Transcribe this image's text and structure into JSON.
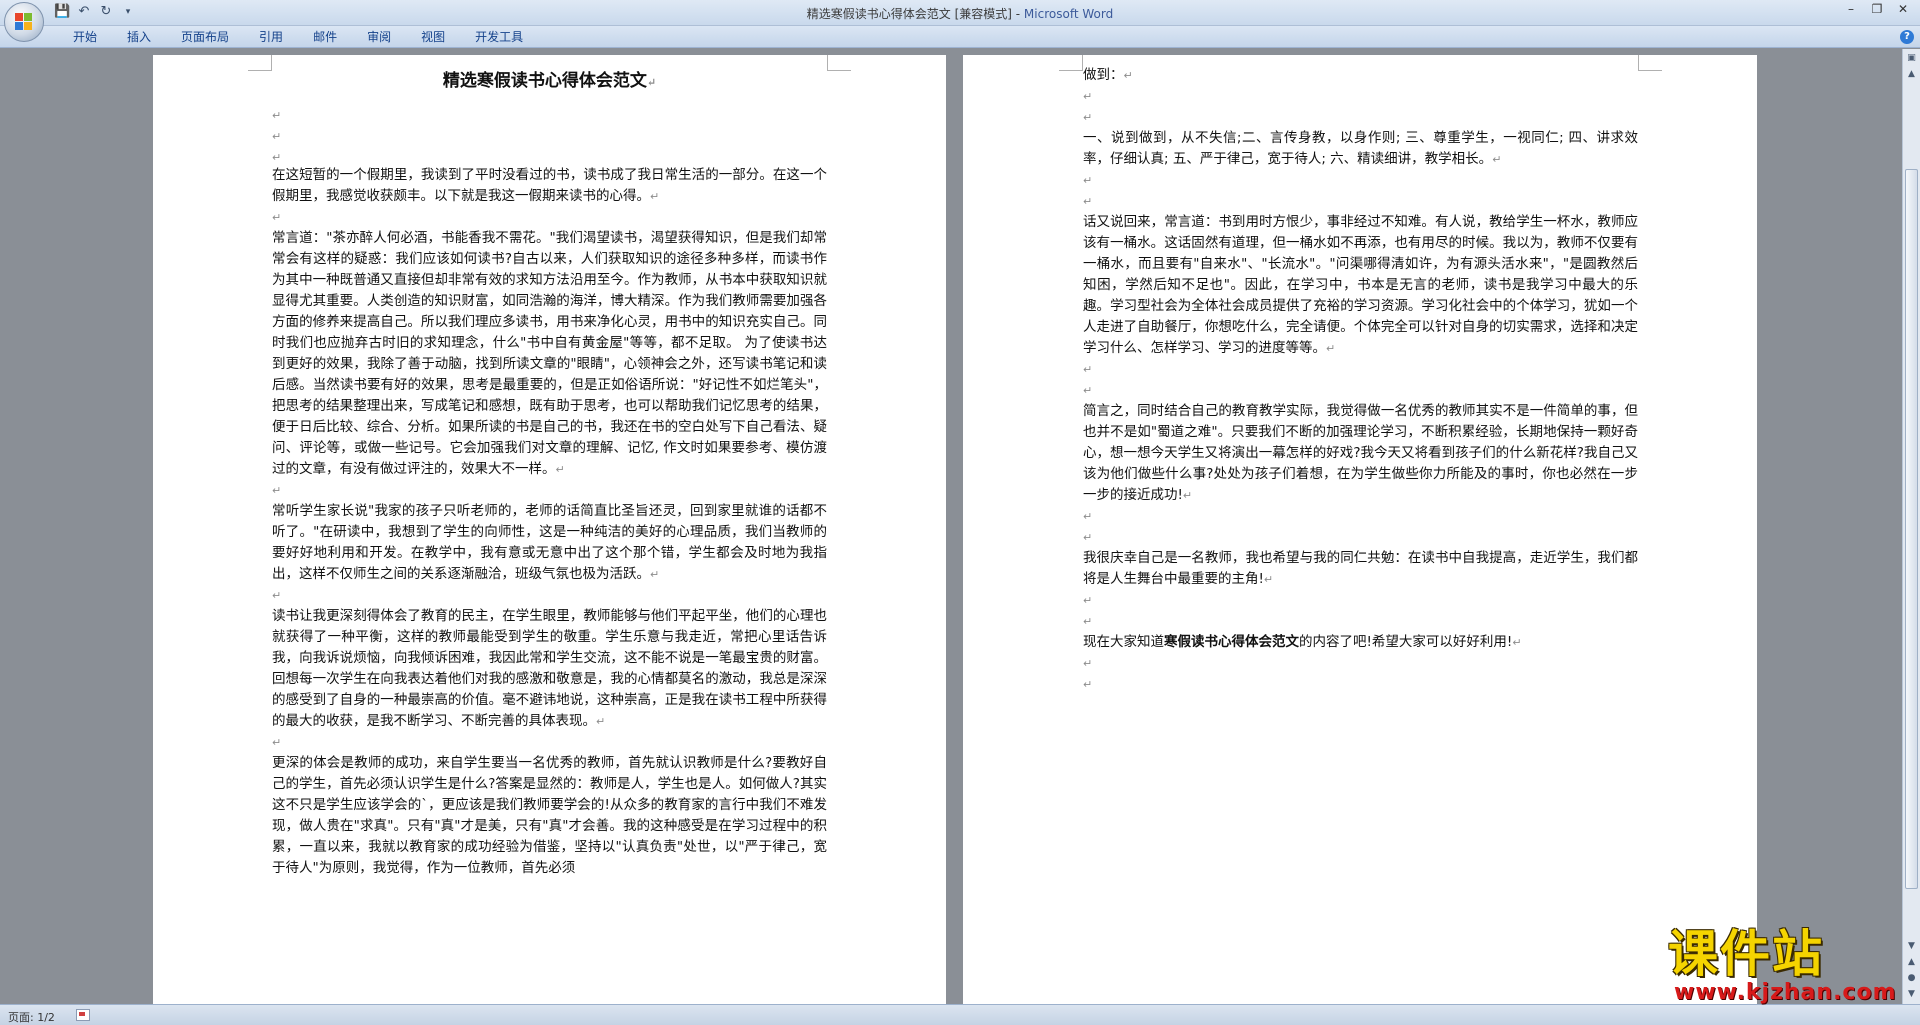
{
  "window": {
    "title": "精选寒假读书心得体会范文 [兼容模式] - ",
    "product": "Microsoft Word"
  },
  "ribbon": {
    "tabs": [
      "开始",
      "插入",
      "页面布局",
      "引用",
      "邮件",
      "审阅",
      "视图",
      "开发工具"
    ]
  },
  "status": {
    "page": "页面: 1/2"
  },
  "watermark": {
    "text": "课件站",
    "url": "www.kjzhan.com"
  },
  "document": {
    "title": "精选寒假读书心得体会范文",
    "page1": [
      "在这短暂的一个假期里，我读到了平时没看过的书，读书成了我日常生活的一部分。在这一个假期里，我感觉收获颇丰。以下就是我这一假期来读书的心得。",
      "常言道：\"茶亦醉人何必酒，书能香我不需花。\"我们渴望读书，渴望获得知识，但是我们却常常会有这样的疑惑：我们应该如何读书?自古以来，人们获取知识的途径多种多样，而读书作为其中一种既普通又直接但却非常有效的求知方法沿用至今。作为教师，从书本中获取知识就显得尤其重要。人类创造的知识财富，如同浩瀚的海洋，博大精深。作为我们教师需要加强各方面的修养来提高自己。所以我们理应多读书，用书来净化心灵，用书中的知识充实自己。同时我们也应抛弃古时旧的求知理念，什么\"书中自有黄金屋\"等等，都不足取。     为了使读书达到更好的效果，我除了善于动脑，找到所读文章的\"眼睛\"，心领神会之外，还写读书笔记和读后感。当然读书要有好的效果，思考是最重要的，但是正如俗语所说：\"好记性不如烂笔头\"，把思考的结果整理出来，写成笔记和感想，既有助于思考，也可以帮助我们记忆思考的结果，便于日后比较、综合、分析。如果所读的书是自己的书，我还在书的空白处写下自己看法、疑问、评论等，或做一些记号。它会加强我们对文章的理解、记忆, 作文时如果要参考、模仿渡过的文章，有没有做过评注的，效果大不一样。",
      "常听学生家长说\"我家的孩子只听老师的，老师的话简直比圣旨还灵，回到家里就谁的话都不听了。\"在研读中，我想到了学生的向师性，这是一种纯洁的美好的心理品质，我们当教师的要好好地利用和开发。在教学中，我有意或无意中出了这个那个错，学生都会及时地为我指出，这样不仅师生之间的关系逐渐融洽，班级气氛也极为活跃。",
      "读书让我更深刻得体会了教育的民主，在学生眼里，教师能够与他们平起平坐，他们的心理也就获得了一种平衡，这样的教师最能受到学生的敬重。学生乐意与我走近，常把心里话告诉我，向我诉说烦恼，向我倾诉困难，我因此常和学生交流，这不能不说是一笔最宝贵的财富。回想每一次学生在向我表达着他们对我的感激和敬意是，我的心情都莫名的激动，我总是深深的感受到了自身的一种最崇高的价值。毫不避讳地说，这种崇高，正是我在读书工程中所获得的最大的收获，是我不断学习、不断完善的具体表现。",
      "更深的体会是教师的成功，来自学生要当一名优秀的教师，首先就认识教师是什么?要教好自己的学生，首先必须认识学生是什么?答案是显然的：教师是人，学生也是人。如何做人?其实这不只是学生应该学会的`，更应该是我们教师要学会的!从众多的教育家的言行中我们不难发现，做人贵在\"求真\"。只有\"真\"才是美，只有\"真\"才会善。我的这种感受是在学习过程中的积累，一直以来，我就以教育家的成功经验为借鉴，坚持以\"认真负责\"处世，以\"严于律己，宽于待人\"为原则，我觉得，作为一位教师，首先必须"
    ],
    "page2": {
      "p1": "做到：",
      "p2": "一、说到做到，从不失信;二、言传身教，以身作则;      三、尊重学生，一视同仁;      四、讲求效率，仔细认真;      五、严于律己，宽于待人;      六、精读细讲，教学相长。",
      "p3": "话又说回来，常言道：书到用时方恨少，事非经过不知难。有人说，教给学生一杯水，教师应该有一桶水。这话固然有道理，但一桶水如不再添，也有用尽的时候。我以为，教师不仅要有一桶水，而且要有\"自来水\"、\"长流水\"。\"问渠哪得清如许，为有源头活水来\"，\"是圆教然后知困，学然后知不足也\"。因此，在学习中，书本是无言的老师，读书是我学习中最大的乐趣。学习型社会为全体社会成员提供了充裕的学习资源。学习化社会中的个体学习，犹如一个人走进了自助餐厅，你想吃什么，完全请便。个体完全可以针对自身的切实需求，选择和决定学习什么、怎样学习、学习的进度等等。",
      "p4": "简言之，同时结合自己的教育教学实际，我觉得做一名优秀的教师其实不是一件简单的事，但也并不是如\"蜀道之难\"。只要我们不断的加强理论学习，不断积累经验，长期地保持一颗好奇心，想一想今天学生又将演出一幕怎样的好戏?我今天又将看到孩子们的什么新花样?我自己又该为他们做些什么事?处处为孩子们着想，在为学生做些你力所能及的事时，你也必然在一步一步的接近成功!",
      "p5": "我很庆幸自己是一名教师，我也希望与我的同仁共勉：在读书中自我提高，走近学生，我们都将是人生舞台中最重要的主角!",
      "p6_pre": "现在大家知道",
      "p6_bold": "寒假读书心得体会范文",
      "p6_post": "的内容了吧!希望大家可以好好利用!"
    }
  },
  "colors": {
    "workspace": "#8a8f96",
    "ribbon_text": "#15428b",
    "product_title": "#3c5a9a",
    "watermark_main": "#f5d400",
    "watermark_url": "#d71a1a"
  }
}
